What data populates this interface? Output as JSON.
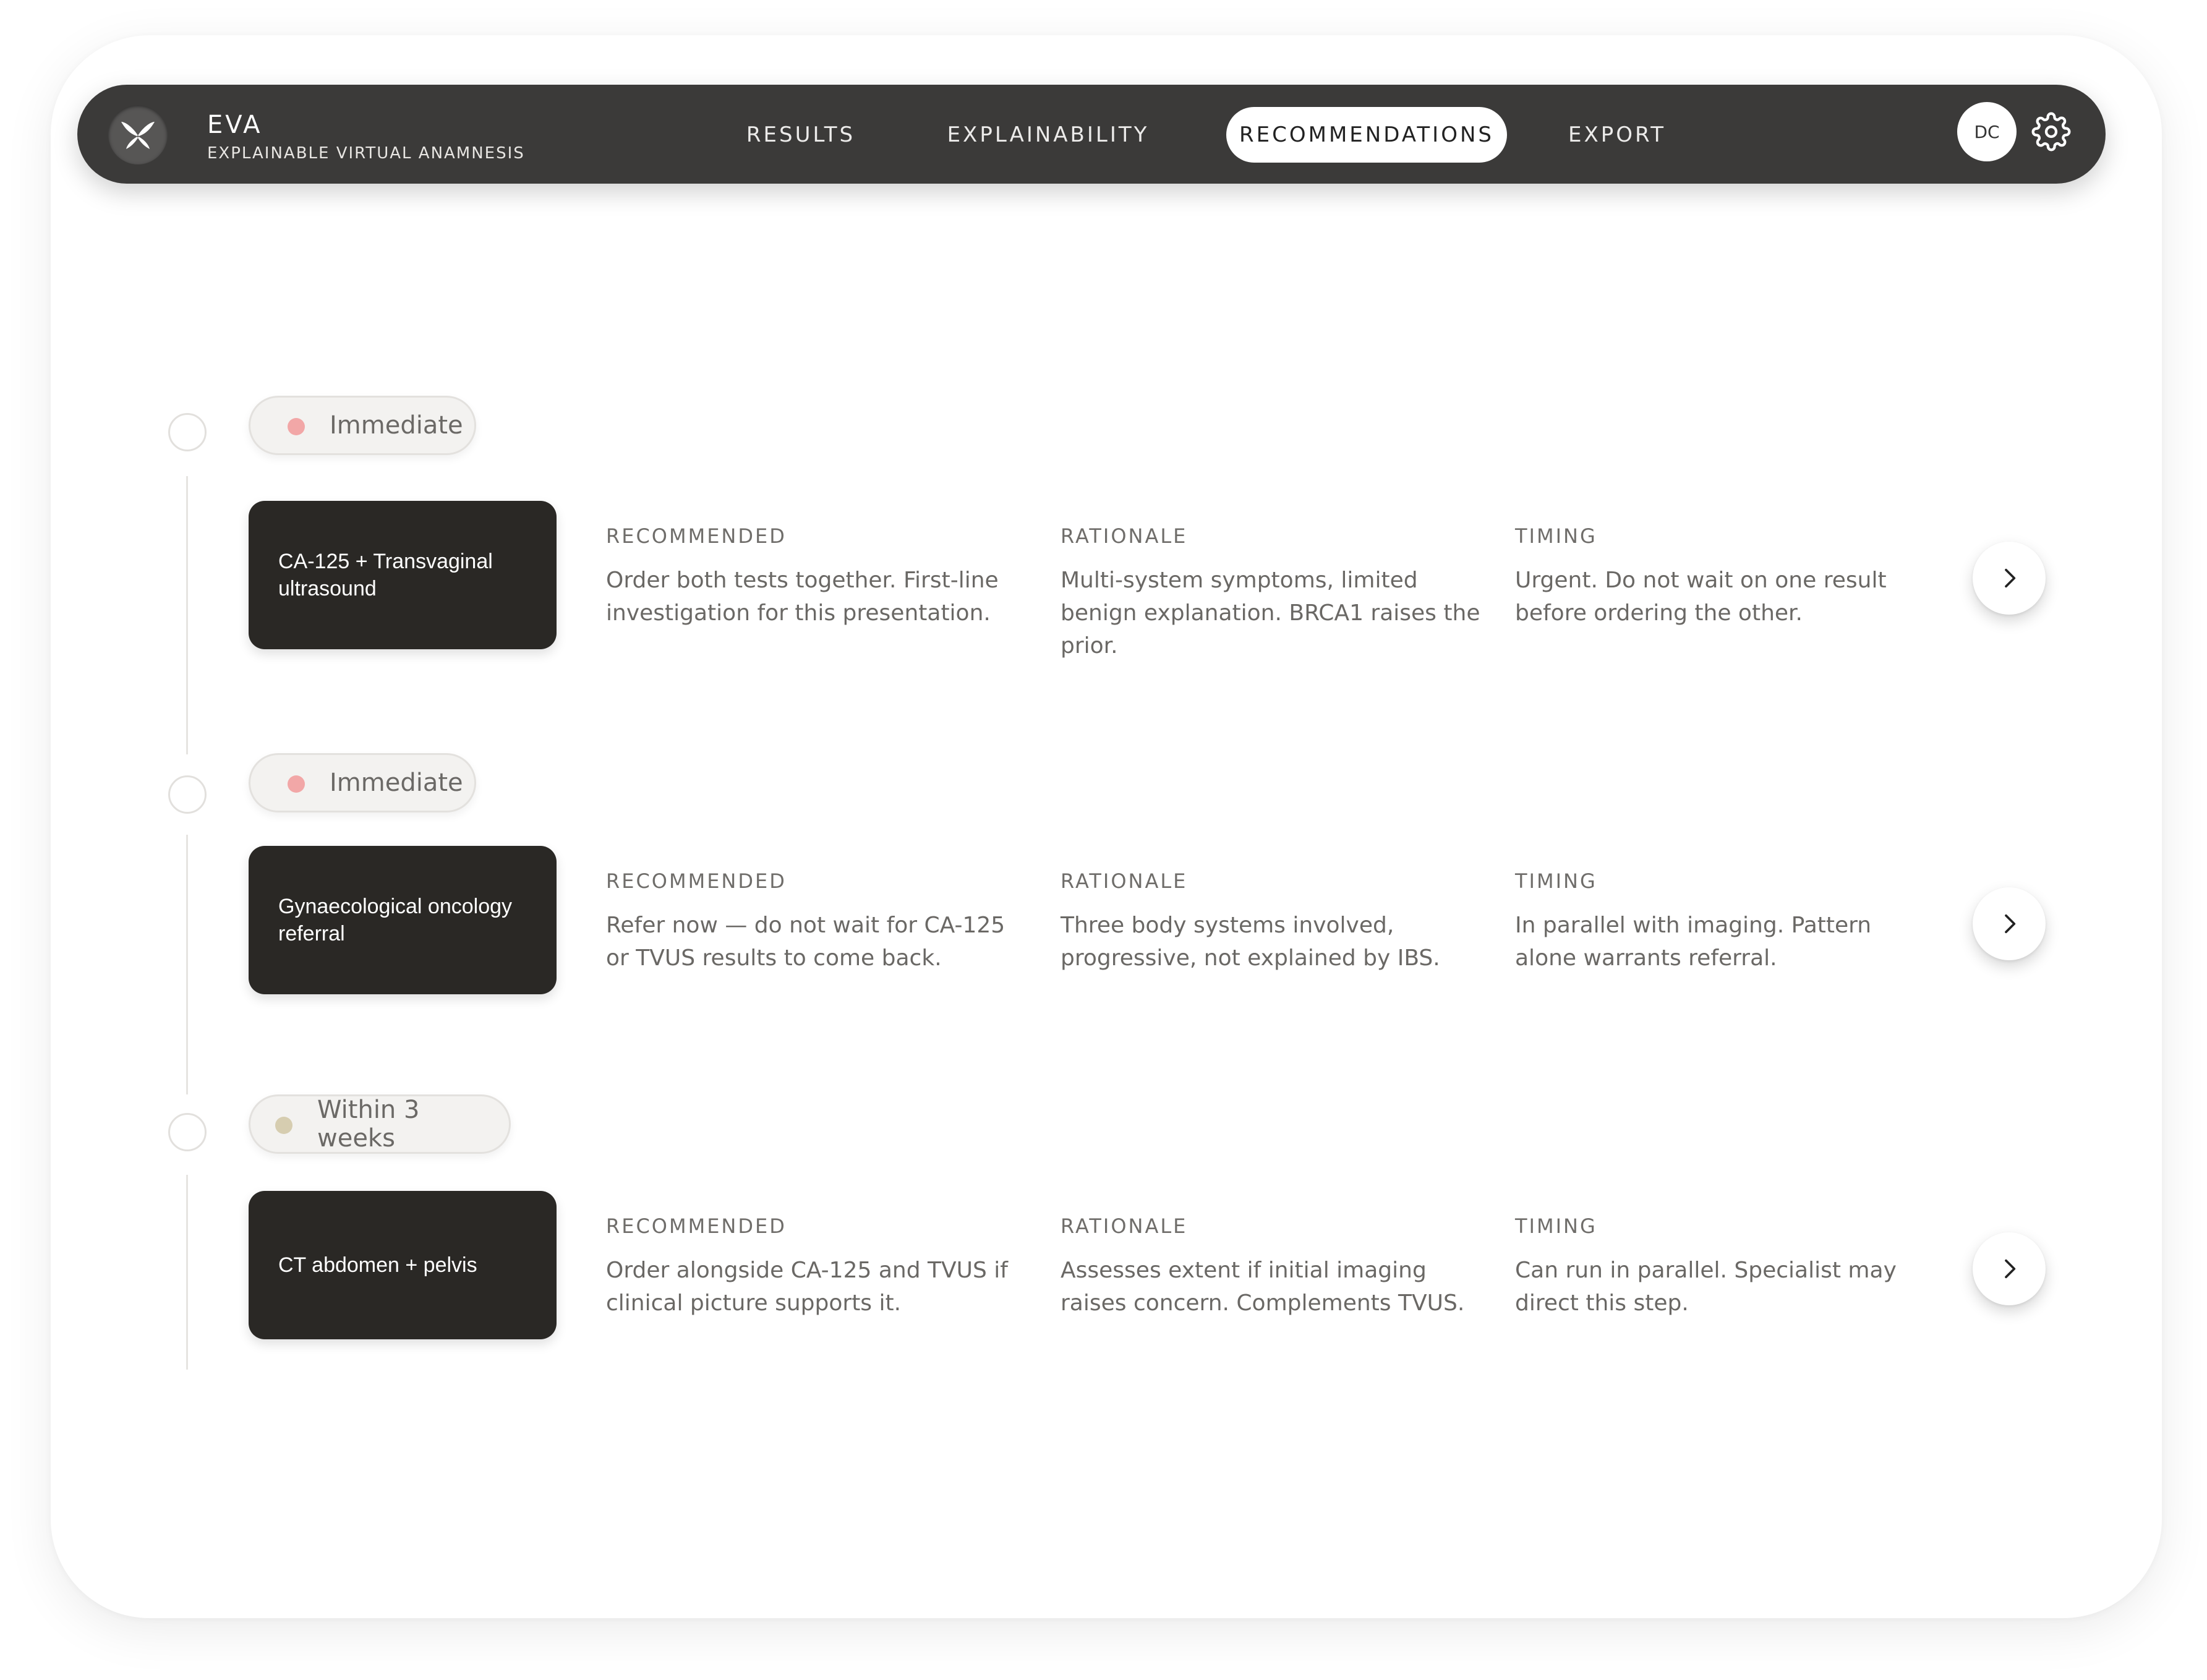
{
  "app": {
    "title": "EVA",
    "subtitle": "EXPLAINABLE VIRTUAL ANAMNESIS",
    "logo_icon": "butterfly-icon"
  },
  "nav": {
    "tabs": [
      {
        "label": "RESULTS",
        "active": false
      },
      {
        "label": "EXPLAINABILITY",
        "active": false
      },
      {
        "label": "RECOMMENDATIONS",
        "active": true
      },
      {
        "label": "EXPORT",
        "active": false
      }
    ],
    "avatar_initials": "DC",
    "settings_icon": "gear-icon"
  },
  "colors": {
    "nav_bg": "#3b3a39",
    "card_bg": "#2a2825",
    "immediate_dot": "#f2a7a7",
    "within_dot": "#d6cdb0"
  },
  "recommendations": [
    {
      "priority": "Immediate",
      "priority_color": "#f2a7a7",
      "action": "CA-125 + Transvaginal ultrasound",
      "recommended_label": "RECOMMENDED",
      "recommended": "Order both tests together. First-line investigation for this presentation.",
      "rationale_label": "RATIONALE",
      "rationale": "Multi-system symptoms, limited benign explanation. BRCA1 raises the prior.",
      "timing_label": "TIMING",
      "timing": "Urgent. Do not wait on one result before ordering the other."
    },
    {
      "priority": "Immediate",
      "priority_color": "#f2a7a7",
      "action": "Gynaecological oncology referral",
      "recommended_label": "RECOMMENDED",
      "recommended": "Refer now — do not wait for CA-125 or TVUS results to come back.",
      "rationale_label": "RATIONALE",
      "rationale": "Three body systems involved, progressive, not explained by IBS.",
      "timing_label": "TIMING",
      "timing": "In parallel with imaging. Pattern alone warrants referral."
    },
    {
      "priority": "Within 3 weeks",
      "priority_color": "#d6cdb0",
      "action": "CT abdomen + pelvis",
      "recommended_label": "RECOMMENDED",
      "recommended": "Order alongside CA-125 and TVUS if clinical picture supports it.",
      "rationale_label": "RATIONALE",
      "rationale": "Assesses extent if initial imaging raises concern. Complements TVUS.",
      "timing_label": "TIMING",
      "timing": "Can run in parallel. Specialist may direct this step."
    }
  ]
}
